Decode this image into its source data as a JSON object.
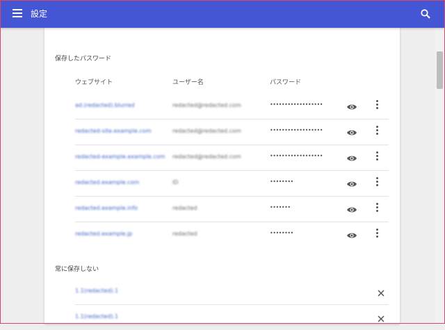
{
  "header": {
    "menu_icon": "hamburger-menu-icon",
    "title": "設定",
    "search_icon": "search-icon"
  },
  "saved_passwords": {
    "heading": "保存したパスワード",
    "columns": {
      "website": "ウェブサイト",
      "username": "ユーザー名",
      "password": "パスワード"
    },
    "rows": [
      {
        "site": "ad.(redacted).blurred",
        "user": "redacted@redacted.com",
        "password": "••••••••••••••••••"
      },
      {
        "site": "redacted-site.example.com",
        "user": "redacted@redacted.com",
        "password": "••••••••••••••••••"
      },
      {
        "site": "redacted-example.example.com",
        "user": "redacted@redacted.com",
        "password": "••••••••••••••••••"
      },
      {
        "site": "redacted.example.com",
        "user": "ID",
        "password": "••••••••"
      },
      {
        "site": "redacted.example.info",
        "user": "redacted",
        "password": "•••••••"
      },
      {
        "site": "redacted.example.jp",
        "user": "redacted",
        "password": "••••••••"
      }
    ]
  },
  "never_saved": {
    "heading": "常に保存しない",
    "rows": [
      {
        "site": "1.1(redacted).1"
      },
      {
        "site": "1.1(redacted).1"
      }
    ]
  },
  "icons": {
    "show": "eye-icon",
    "more": "more-vert-icon",
    "remove": "close-icon"
  },
  "colors": {
    "header_bg": "#4556d4",
    "link": "#3f63c9"
  }
}
